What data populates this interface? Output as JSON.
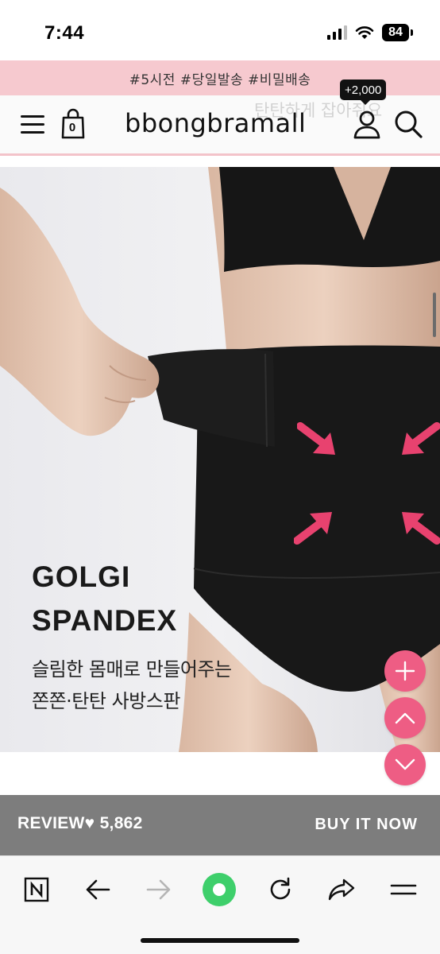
{
  "status_bar": {
    "time": "7:44",
    "battery": "84"
  },
  "promo_banner": {
    "text": "#5시전 #당일발송 #비밀배송"
  },
  "header": {
    "logo": "bbongbramall",
    "cart_count": "0",
    "points_badge": "+2,000",
    "ghost_text": "탄탄하게 잡아줘요"
  },
  "hero": {
    "title_lines": [
      "GOLGI",
      "SPANDEX"
    ],
    "subtitle_lines": [
      "슬림한 몸매로 만들어주는",
      "쫀쫀·탄탄 사방스판"
    ],
    "accent_color": "#e8426f"
  },
  "floating_buttons": {
    "add": "plus-icon",
    "scroll_top": "chevron-up-icon",
    "scroll_bottom": "chevron-down-icon",
    "color": "#ee5d84"
  },
  "review_bar": {
    "review_label": "REVIEW",
    "heart": "♥",
    "review_count": "5,862",
    "buy_label": "BUY IT NOW",
    "background": "#7d7d7d"
  },
  "toolbar": {
    "items": [
      "naver-icon",
      "back-icon",
      "forward-icon",
      "home-icon",
      "refresh-icon",
      "share-icon",
      "menu-icon"
    ]
  }
}
